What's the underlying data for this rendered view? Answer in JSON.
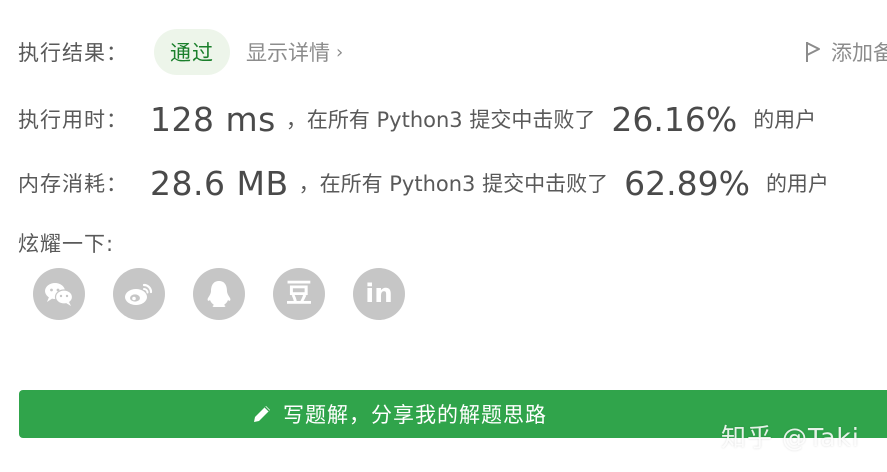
{
  "result": {
    "label": "执行结果：",
    "status": "通过",
    "details_link": "显示详情",
    "details_chevron": "›",
    "add_note": "添加备"
  },
  "runtime": {
    "label": "执行用时：",
    "value": "128 ms",
    "text_before": "，在所有 Python3 提交中击败了",
    "percent": "26.16%",
    "text_after": "的用户"
  },
  "memory": {
    "label": "内存消耗：",
    "value": "28.6 MB",
    "text_before": "，在所有 Python3 提交中击败了",
    "percent": "62.89%",
    "text_after": "的用户"
  },
  "share": {
    "label": "炫耀一下:",
    "icons": [
      "wechat-icon",
      "weibo-icon",
      "qq-icon",
      "douban-icon",
      "linkedin-icon"
    ],
    "douban_glyph": "豆",
    "linkedin_glyph": "in"
  },
  "write_solution": {
    "label": "写题解，分享我的解题思路",
    "color": "#30a44b"
  },
  "watermark": {
    "text": "知乎 @Taki"
  },
  "colors": {
    "status_bg": "#edf5ea",
    "status_text": "#1a7f2b",
    "share_icon_bg": "#c6c6c6"
  }
}
